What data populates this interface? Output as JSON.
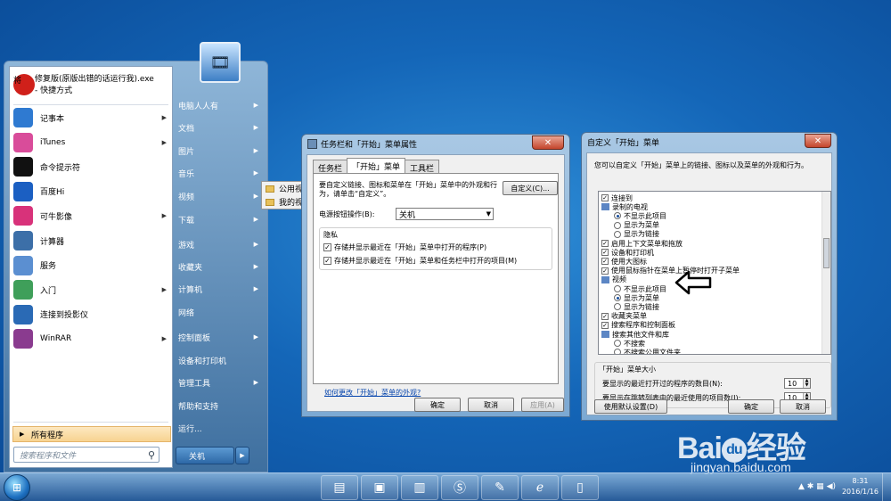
{
  "start_menu": {
    "pinned": {
      "label1": "修复版(原版出错的话运行我).exe",
      "label2": "- 快捷方式",
      "icon": "app-red-circle-icon"
    },
    "items": [
      {
        "label": "记事本",
        "icon": "notepad-icon",
        "arrow": true
      },
      {
        "label": "iTunes",
        "icon": "itunes-icon",
        "arrow": true
      },
      {
        "label": "命令提示符",
        "icon": "cmd-icon",
        "arrow": false
      },
      {
        "label": "百度Hi",
        "icon": "baidu-hi-icon",
        "arrow": false
      },
      {
        "label": "可牛影像",
        "icon": "keniu-icon",
        "arrow": true
      },
      {
        "label": "计算器",
        "icon": "calculator-icon",
        "arrow": false
      },
      {
        "label": "服务",
        "icon": "services-icon",
        "arrow": false
      },
      {
        "label": "入门",
        "icon": "getting-started-icon",
        "arrow": true
      },
      {
        "label": "连接到投影仪",
        "icon": "projector-icon",
        "arrow": false
      },
      {
        "label": "WinRAR",
        "icon": "winrar-icon",
        "arrow": true
      }
    ],
    "all_programs": "所有程序",
    "search_placeholder": "搜索程序和文件",
    "right_items": [
      {
        "label": "电脑人人有",
        "arrow": true
      },
      {
        "label": "文档",
        "arrow": true
      },
      {
        "label": "图片",
        "arrow": true
      },
      {
        "label": "音乐",
        "arrow": true
      },
      {
        "label": "视频",
        "arrow": true
      },
      {
        "label": "下载",
        "arrow": true
      },
      {
        "label": "游戏",
        "arrow": true
      },
      {
        "label": "收藏夹",
        "arrow": true
      },
      {
        "label": "计算机",
        "arrow": true
      },
      {
        "label": "网络",
        "arrow": false
      },
      {
        "label": "控制面板",
        "arrow": true
      },
      {
        "label": "设备和打印机",
        "arrow": false
      },
      {
        "label": "管理工具",
        "arrow": true
      },
      {
        "label": "帮助和支持",
        "arrow": false
      },
      {
        "label": "运行...",
        "arrow": false
      }
    ],
    "shutdown": "关机"
  },
  "submenu": {
    "items": [
      "公用视频",
      "我的视频"
    ]
  },
  "taskbar_props": {
    "title": "任务栏和「开始」菜单属性",
    "tabs": [
      "任务栏",
      "「开始」菜单",
      "工具栏"
    ],
    "active_tab": 1,
    "desc": "要自定义链接、图标和菜单在「开始」菜单中的外观和行为，请单击“自定义”。",
    "customize_btn": "自定义(C)...",
    "power_label": "电源按钮操作(B):",
    "power_value": "关机",
    "privacy_title": "隐私",
    "privacy_chk1": "存储并显示最近在「开始」菜单中打开的程序(P)",
    "privacy_chk2": "存储并显示最近在「开始」菜单和任务栏中打开的项目(M)",
    "link": "如何更改「开始」菜单的外观?",
    "ok": "确定",
    "cancel": "取消",
    "apply": "应用(A)"
  },
  "customize": {
    "title": "自定义「开始」菜单",
    "desc": "您可以自定义「开始」菜单上的链接、图标以及菜单的外观和行为。",
    "tree": [
      {
        "type": "check",
        "checked": true,
        "label": "连接到",
        "indent": 0
      },
      {
        "type": "folder",
        "label": "录制的电视",
        "indent": 0
      },
      {
        "type": "radio",
        "on": true,
        "label": "不显示此项目",
        "indent": 1
      },
      {
        "type": "radio",
        "on": false,
        "label": "显示为菜单",
        "indent": 1
      },
      {
        "type": "radio",
        "on": false,
        "label": "显示为链接",
        "indent": 1
      },
      {
        "type": "check",
        "checked": true,
        "label": "启用上下文菜单和拖放",
        "indent": 0
      },
      {
        "type": "check",
        "checked": true,
        "label": "设备和打印机",
        "indent": 0
      },
      {
        "type": "check",
        "checked": true,
        "label": "使用大图标",
        "indent": 0
      },
      {
        "type": "check",
        "checked": true,
        "label": "使用鼠标指针在菜单上暂停时打开子菜单",
        "indent": 0
      },
      {
        "type": "folder",
        "label": "视频",
        "indent": 0
      },
      {
        "type": "radio",
        "on": false,
        "label": "不显示此项目",
        "indent": 1
      },
      {
        "type": "radio",
        "on": true,
        "label": "显示为菜单",
        "indent": 1
      },
      {
        "type": "radio",
        "on": false,
        "label": "显示为链接",
        "indent": 1
      },
      {
        "type": "check",
        "checked": true,
        "label": "收藏夹菜单",
        "indent": 0
      },
      {
        "type": "check",
        "checked": true,
        "label": "搜索程序和控制面板",
        "indent": 0
      },
      {
        "type": "folder",
        "label": "搜索其他文件和库",
        "indent": 0
      },
      {
        "type": "radio",
        "on": false,
        "label": "不搜索",
        "indent": 1
      },
      {
        "type": "radio",
        "on": false,
        "label": "不搜索公用文件夹",
        "indent": 1
      }
    ],
    "size_title": "「开始」菜单大小",
    "size_label1": "要显示的最近打开过的程序的数目(N):",
    "size_val1": "10",
    "size_label2": "要显示在跳转列表中的最近使用的项目数(J):",
    "size_val2": "10",
    "defaults_btn": "使用默认设置(D)",
    "ok": "确定",
    "cancel": "取消"
  },
  "taskbar": {
    "clock_time": "8:31",
    "clock_date": "2016/1/16"
  },
  "watermark": {
    "brand": "Bai",
    "brand2": "经验",
    "url": "jingyan.baidu.com"
  }
}
